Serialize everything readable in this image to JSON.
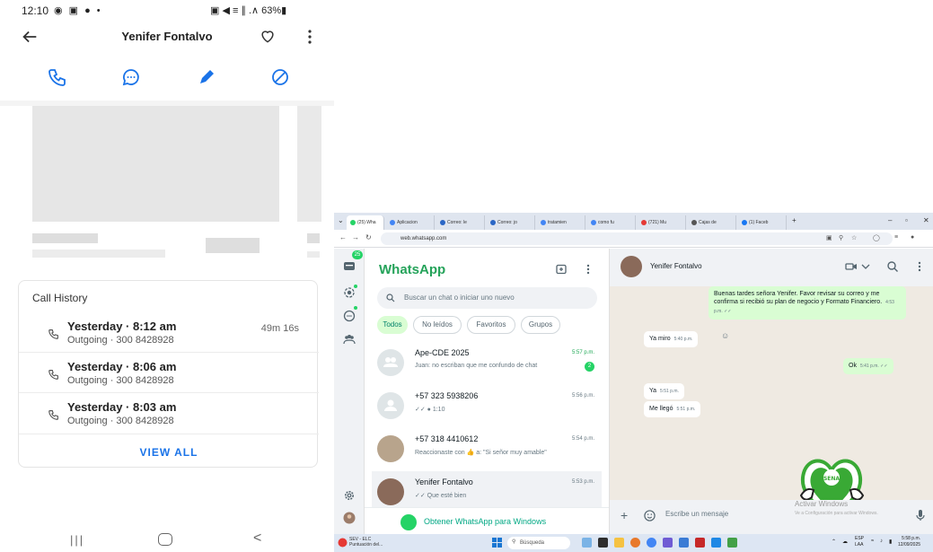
{
  "phone": {
    "status": {
      "time": "12:10",
      "indicators": "◉ ▣ ● •",
      "right": "▣ ◀ ≡ ∥ .∧ 63%▮"
    },
    "contact_name": "Yenifer Fontalvo",
    "call_history": {
      "title": "Call History",
      "duration": "49m 16s",
      "rows": [
        {
          "when": "Yesterday · 8:12 am",
          "detail": "Outgoing · 300 8428928"
        },
        {
          "when": "Yesterday · 8:06 am",
          "detail": "Outgoing · 300 8428928"
        },
        {
          "when": "Yesterday · 8:03 am",
          "detail": "Outgoing · 300 8428928"
        }
      ],
      "view_all": "VIEW ALL"
    },
    "nav": {
      "recent": "|||",
      "back": "<"
    }
  },
  "browser": {
    "tabs": [
      {
        "label": "(25) Wha",
        "color": "#25d366"
      },
      {
        "label": "Aplicacion",
        "color": "#4285f4"
      },
      {
        "label": "Correo: le",
        "color": "#2a66c5"
      },
      {
        "label": "Correo: jo",
        "color": "#2a66c5"
      },
      {
        "label": "tratamien",
        "color": "#4285f4"
      },
      {
        "label": "como fu",
        "color": "#4285f4"
      },
      {
        "label": "(721) Mu",
        "color": "#e53935"
      },
      {
        "label": "Cajas de",
        "color": "#555555"
      },
      {
        "label": "(1) Faceb",
        "color": "#1877f2"
      }
    ],
    "new_tab": "+",
    "url": "web.whatsapp.com"
  },
  "whatsapp": {
    "unread_badge": "25",
    "brand": "WhatsApp",
    "search_placeholder": "Buscar un chat o iniciar uno nuevo",
    "filters": [
      "Todos",
      "No leídos",
      "Favoritos",
      "Grupos"
    ],
    "chats": [
      {
        "name": "Ape-CDE 2025",
        "time": "5:57 p.m.",
        "preview": "Juan: no escriban que me confundo de chat",
        "unread": "2",
        "time_green": true
      },
      {
        "name": "+57 323 5938206",
        "time": "5:56 p.m.",
        "preview": "✓✓ ● 1:10",
        "unread": "",
        "time_green": false
      },
      {
        "name": "+57 318 4410612",
        "time": "5:54 p.m.",
        "preview": "Reaccionaste con 👍 a: \"Si señor muy amable\"",
        "unread": "",
        "time_green": false
      },
      {
        "name": "Yenifer Fontalvo",
        "time": "5:53 p.m.",
        "preview": "✓✓ Que esté bien",
        "unread": "",
        "time_green": false
      }
    ],
    "get_app": "Obtener WhatsApp para Windows",
    "conversation": {
      "contact": "Yenifer Fontalvo",
      "messages": [
        {
          "dir": "out",
          "text": "Buenas tardes señora Yenifer. Favor revisar su correo y me confirma si recibió su plan de negocio y Formato Financiero.",
          "time": "4:53 p.m. ✓✓"
        },
        {
          "dir": "in",
          "text": "Ya miro",
          "time": "5:40 p.m."
        },
        {
          "dir": "out",
          "text": "Ok",
          "time": "5:41 p.m. ✓✓"
        },
        {
          "dir": "in",
          "text": "Ya",
          "time": "5:51 p.m."
        },
        {
          "dir": "in",
          "text": "Me llegó",
          "time": "5:51 p.m."
        }
      ],
      "input_placeholder": "Escribe un mensaje",
      "activate_title": "Activar Windows",
      "activate_sub": "Ve a Configuración para activar Windows.",
      "logo_text": "SENA"
    }
  },
  "taskbar": {
    "news_title": "SEV - ELC",
    "news_sub": "Puntuación del...",
    "search": "Búsqueda",
    "lang": "ESP",
    "lang_sub": "LAA",
    "time": "5:58 p.m.",
    "date": "12/09/2025"
  }
}
